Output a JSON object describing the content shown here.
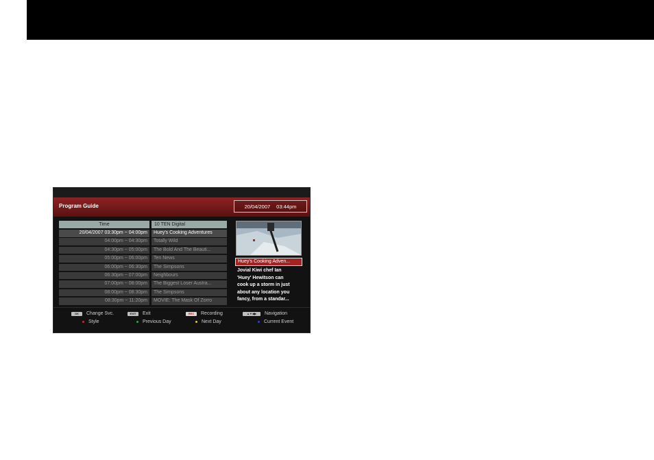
{
  "guide": {
    "title": "Program Guide",
    "date": "20/04/2007",
    "time": "03:44pm",
    "time_header": "Time",
    "channel_header": "10  TEN Digital",
    "rows": [
      {
        "time": "20/04/2007  03:30pm ~ 04:00pm",
        "program": "Huey's Cooking Adventures",
        "selected": true
      },
      {
        "time": "04:00pm ~ 04:30pm",
        "program": "Totally Wild"
      },
      {
        "time": "04:30pm ~ 05:00pm",
        "program": "The Bold And The Beauti..."
      },
      {
        "time": "05:00pm ~ 06:00pm",
        "program": "Ten News"
      },
      {
        "time": "06:00pm ~ 06:30pm",
        "program": "The Simpsons"
      },
      {
        "time": "06:30pm ~ 07:00pm",
        "program": "Neighbours"
      },
      {
        "time": "07:00pm ~ 08:00pm",
        "program": "The Biggest Loser Austra..."
      },
      {
        "time": "08:00pm ~ 08:30pm",
        "program": "The Simpsons"
      },
      {
        "time": "08:30pm ~ 11:20pm",
        "program": "MOVIE: The Mask Of Zorro"
      }
    ],
    "event_title": "Huey's Cooking Adven...",
    "event_desc_lines": [
      "Jovial Kiwi chef Ian",
      "'Huey' Hewitson can",
      "cook up a storm in just",
      "about any location you",
      "fancy, from a standar..."
    ]
  },
  "footer": {
    "keys": {
      "ok": "OK",
      "exit": "EXIT",
      "rec": "REC",
      "nav": "▲▼◀▶"
    },
    "change_svc": "Change Svc.",
    "exit_label": "Exit",
    "recording": "Recording",
    "navigation": "Navigation",
    "style": "Style",
    "prev_day": "Previous Day",
    "next_day": "Next Day",
    "current_event": "Current Event"
  },
  "colors": {
    "red": "#d42a2a",
    "green": "#2fae3a",
    "yellow": "#d8cc2a",
    "blue": "#2a44d4",
    "header_red": "#8e2323"
  }
}
